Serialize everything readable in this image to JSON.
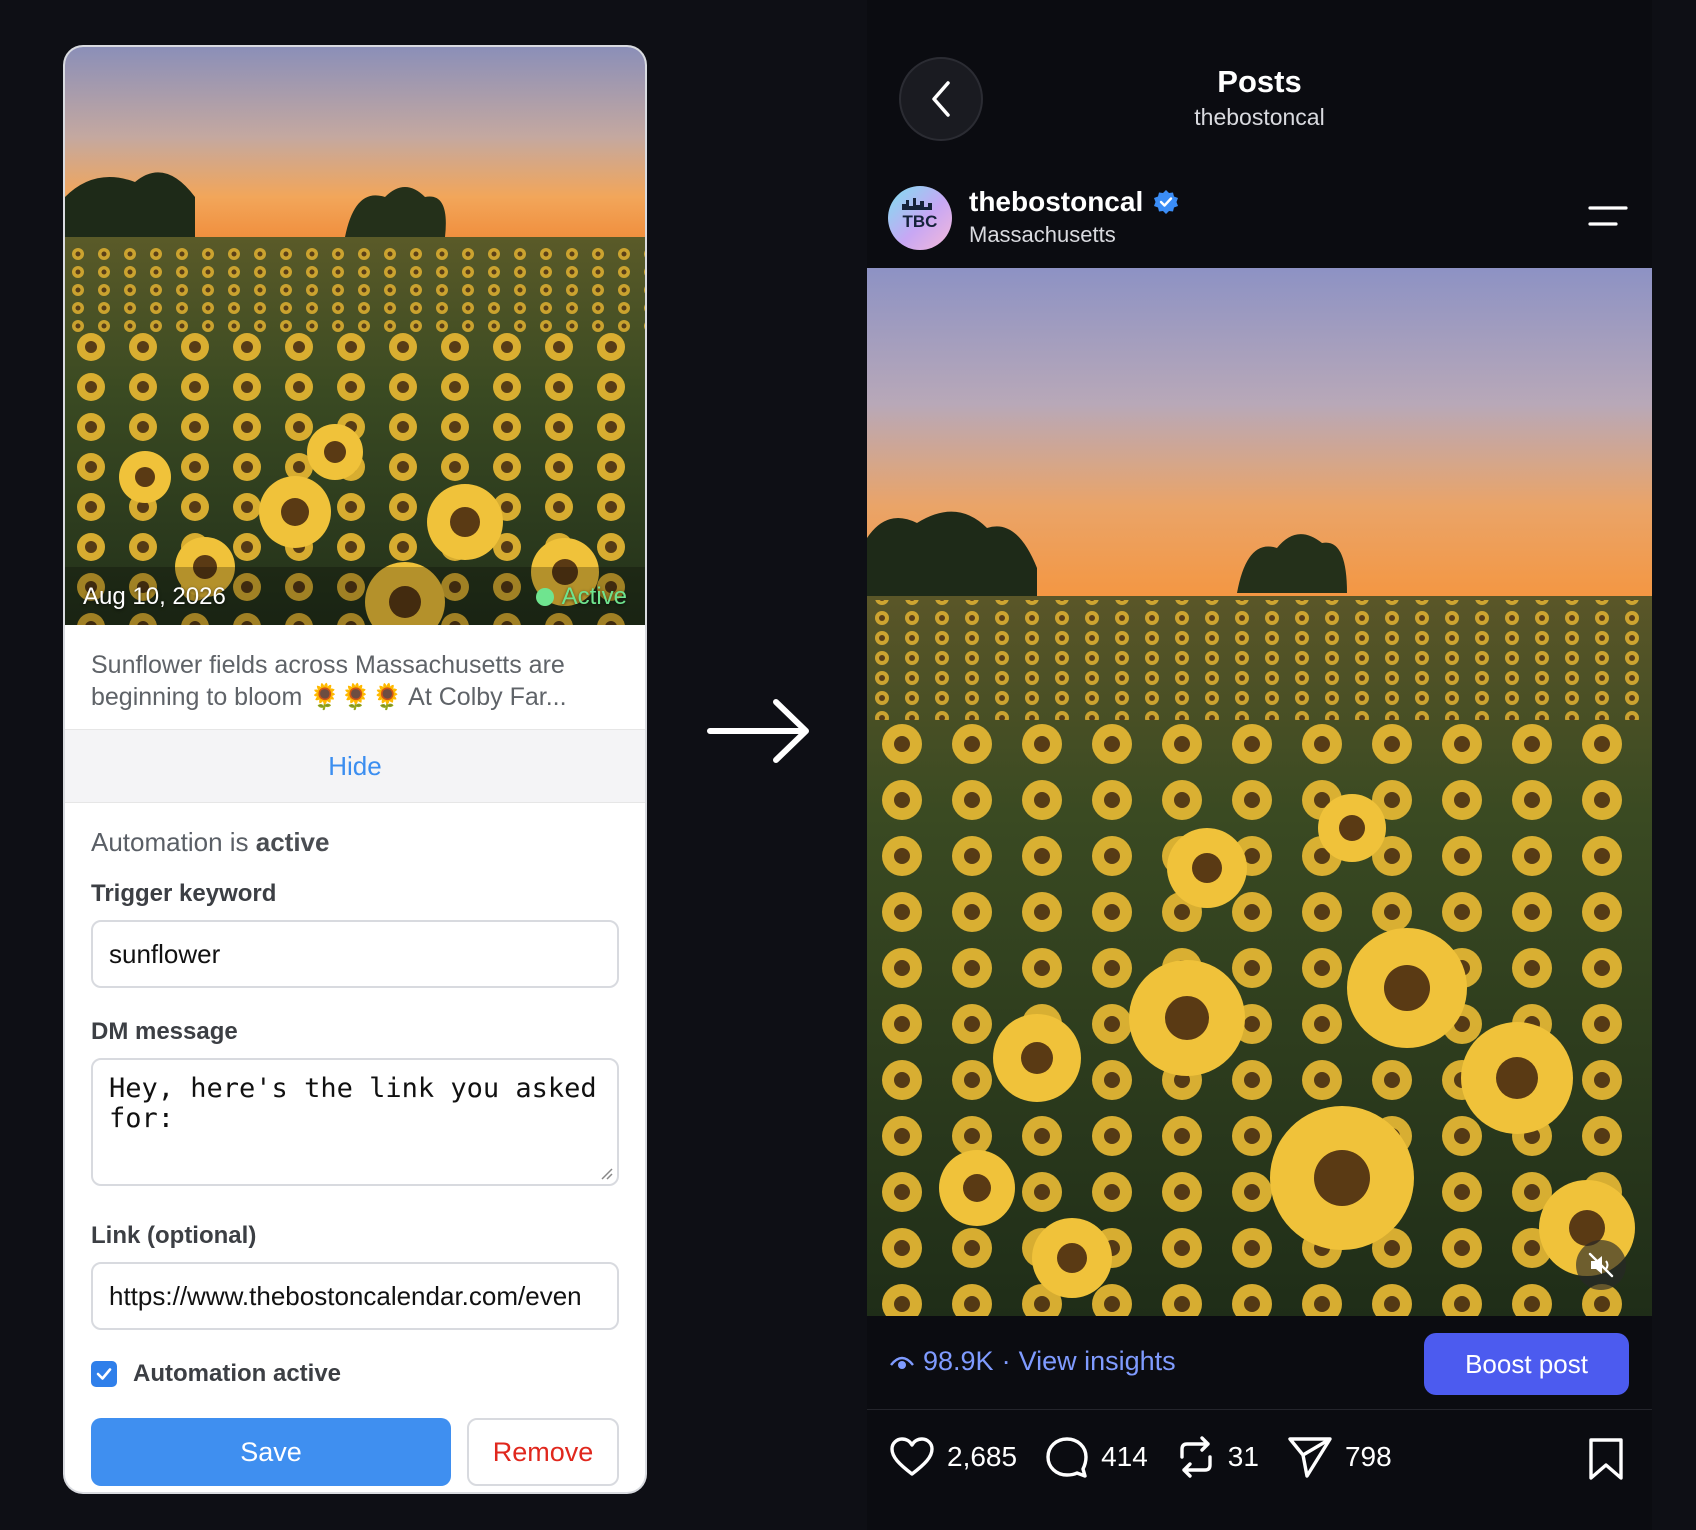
{
  "left_card": {
    "date": "Aug 10, 2026",
    "status": "Active",
    "caption": "Sunflower fields across Massachusetts are beginning to bloom 🌻🌻🌻 At Colby Far...",
    "hide_label": "Hide",
    "automation_prefix": "Automation is ",
    "automation_state": "active",
    "trigger_label": "Trigger keyword",
    "trigger_value": "sunflower",
    "dm_label": "DM message",
    "dm_value": "Hey, here's the link you asked for:",
    "link_label": "Link (optional)",
    "link_value": "https://www.thebostoncalendar.com/even",
    "checkbox_label": "Automation active",
    "checkbox_checked": true,
    "save_label": "Save",
    "remove_label": "Remove"
  },
  "arrow_icon": "arrow-right-icon",
  "phone": {
    "title": "Posts",
    "subtitle": "thebostoncal",
    "account_name": "thebostoncal",
    "account_location": "Massachusetts",
    "avatar_text": "TBC",
    "views": "98.9K",
    "separator": "·",
    "insights_label": "View insights",
    "boost_label": "Boost post",
    "likes": "2,685",
    "comments": "414",
    "reposts": "31",
    "shares": "798"
  },
  "colors": {
    "background": "#0e0f15",
    "accent_blue": "#3f8ff0",
    "active_green": "#6fe48f",
    "remove_red": "#e0271d",
    "boost_purple": "#4c5bef",
    "insights_blue": "#7f9bff"
  }
}
